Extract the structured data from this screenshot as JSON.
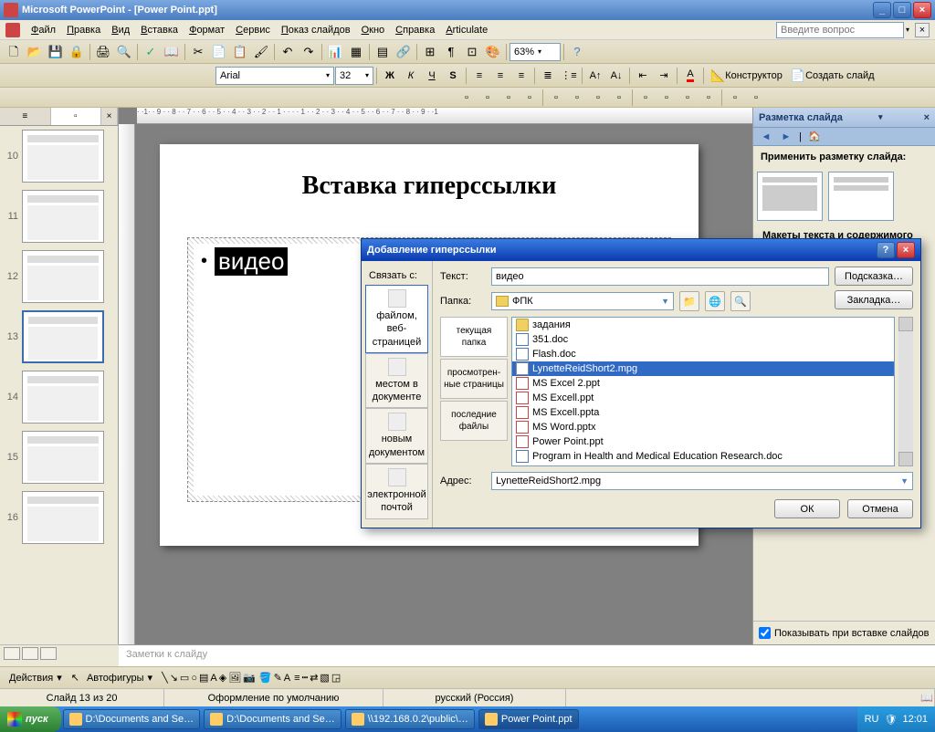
{
  "titlebar": {
    "text": "Microsoft PowerPoint - [Power Point.ppt]"
  },
  "menubar": {
    "items": [
      "Файл",
      "Правка",
      "Вид",
      "Вставка",
      "Формат",
      "Сервис",
      "Показ слайдов",
      "Окно",
      "Справка",
      "Articulate"
    ],
    "help_placeholder": "Введите вопрос"
  },
  "toolbar2": {
    "font": "Arial",
    "size": "32",
    "zoom": "63%",
    "designer": "Конструктор",
    "new_slide": "Создать слайд"
  },
  "thumbs": {
    "items": [
      {
        "num": "10"
      },
      {
        "num": "11"
      },
      {
        "num": "12"
      },
      {
        "num": "13",
        "selected": true
      },
      {
        "num": "14"
      },
      {
        "num": "15"
      },
      {
        "num": "16"
      }
    ]
  },
  "slide": {
    "title": "Вставка гиперссылки",
    "bullet_text": "видео"
  },
  "task_pane": {
    "title": "Разметка слайда",
    "apply_label": "Применить разметку слайда:",
    "section2": "Макеты текста и содержимого",
    "show_on_insert": "Показывать при вставке слайдов"
  },
  "notes": {
    "placeholder": "Заметки к слайду"
  },
  "draw_toolbar": {
    "actions": "Действия",
    "autoshapes": "Автофигуры"
  },
  "status": {
    "slide": "Слайд 13 из 20",
    "design": "Оформление по умолчанию",
    "lang": "русский (Россия)"
  },
  "dialog": {
    "title": "Добавление гиперссылки",
    "link_with": "Связать с:",
    "text_label": "Текст:",
    "text_value": "видео",
    "hint_btn": "Подсказка…",
    "folder_label": "Папка:",
    "folder_value": "ФПК",
    "bookmark_btn": "Закладка…",
    "link_types": [
      {
        "label": "файлом, веб-страницей",
        "selected": true
      },
      {
        "label": "местом в документе"
      },
      {
        "label": "новым документом"
      },
      {
        "label": "электронной почтой"
      }
    ],
    "file_tabs": [
      {
        "label": "текущая папка",
        "selected": true
      },
      {
        "label": "просмотрен-ные страницы"
      },
      {
        "label": "последние файлы"
      }
    ],
    "files": [
      {
        "name": "задания",
        "type": "folder"
      },
      {
        "name": "351.doc",
        "type": "doc"
      },
      {
        "name": "Flash.doc",
        "type": "doc"
      },
      {
        "name": "LynetteReidShort2.mpg",
        "type": "vid",
        "selected": true
      },
      {
        "name": "MS Excel 2.ppt",
        "type": "ppt"
      },
      {
        "name": "MS Excell.ppt",
        "type": "ppt"
      },
      {
        "name": "MS Excell.ppta",
        "type": "ppt"
      },
      {
        "name": "MS Word.pptx",
        "type": "ppt"
      },
      {
        "name": "Power Point.ppt",
        "type": "ppt"
      },
      {
        "name": "Program in Health and Medical Education Research.doc",
        "type": "doc"
      }
    ],
    "address_label": "Адрес:",
    "address_value": "LynetteReidShort2.mpg",
    "ok": "ОК",
    "cancel": "Отмена"
  },
  "taskbar": {
    "start": "пуск",
    "items": [
      {
        "label": "D:\\Documents and Se…"
      },
      {
        "label": "D:\\Documents and Se…"
      },
      {
        "label": "\\\\192.168.0.2\\public\\…"
      },
      {
        "label": "Power Point.ppt",
        "active": true
      }
    ],
    "lang": "RU",
    "time": "12:01"
  }
}
